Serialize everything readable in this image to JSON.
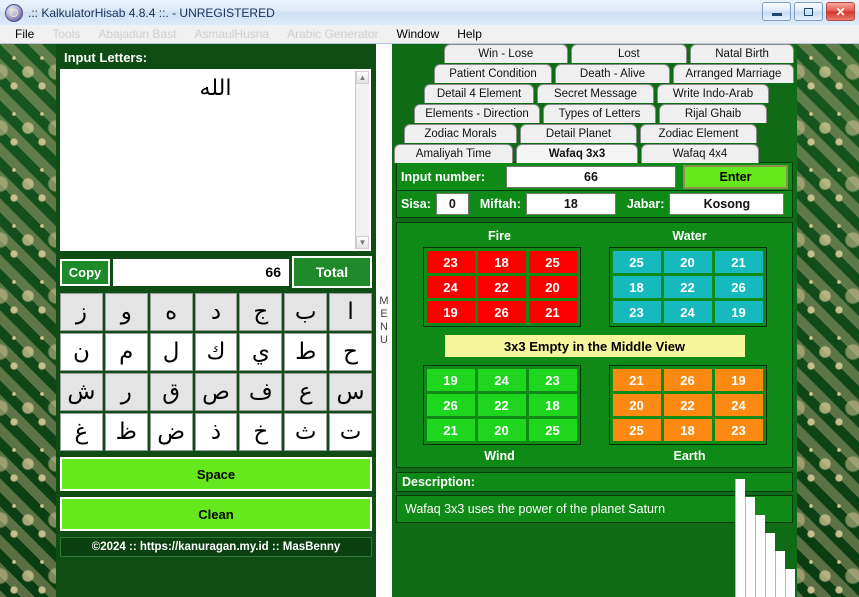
{
  "window": {
    "title": ".:: KalkulatorHisab 4.8.4 ::. - UNREGISTERED",
    "app_icon": "app-gear-icon",
    "minimize_label": "Minimize",
    "maximize_label": "Maximize",
    "close_label": "Close"
  },
  "menubar": {
    "items": [
      {
        "label": "File",
        "enabled": true
      },
      {
        "label": "Tools",
        "enabled": false
      },
      {
        "label": "Abajadun Bast",
        "enabled": false
      },
      {
        "label": "AsmaulHusna",
        "enabled": false
      },
      {
        "label": "Arabic Generator",
        "enabled": false
      },
      {
        "label": "Window",
        "enabled": true
      },
      {
        "label": "Help",
        "enabled": true
      }
    ]
  },
  "left_panel": {
    "title": "Input Letters:",
    "textarea_value": "الله",
    "scroll_up_icon": "chevron-up-icon",
    "scroll_down_icon": "chevron-down-icon",
    "copy_label": "Copy",
    "total_value": "66",
    "total_label": "Total",
    "keypad": [
      "ز",
      "و",
      "ه",
      "د",
      "ج",
      "ب",
      "ا",
      "ن",
      "م",
      "ل",
      "ك",
      "ي",
      "ط",
      "ح",
      "ش",
      "ر",
      "ق",
      "ص",
      "ف",
      "ع",
      "س",
      "غ",
      "ظ",
      "ض",
      "ذ",
      "خ",
      "ث",
      "ت"
    ],
    "space_label": "Space",
    "clean_label": "Clean",
    "footer": "©2024 ::   https://kanuragan.my.id   ::  MasBenny"
  },
  "divider": {
    "menu_letters": [
      "M",
      "E",
      "N",
      "U"
    ]
  },
  "right_panel": {
    "tab_rows": [
      [
        "Win - Lose",
        "Lost",
        "Natal Birth"
      ],
      [
        "Patient Condition",
        "Death - Alive",
        "Arranged Marriage"
      ],
      [
        "Detail 4 Element",
        "Secret Message",
        "Write Indo-Arab"
      ],
      [
        "Elements - Direction",
        "Types of Letters",
        "Rijal Ghaib"
      ],
      [
        "Zodiac Morals",
        "Detail Planet",
        "Zodiac Element"
      ],
      [
        "Amaliyah Time",
        "Wafaq 3x3",
        "Wafaq 4x4"
      ]
    ],
    "active_tab": "Wafaq 3x3",
    "input_number_label": "Input number:",
    "input_number_value": "66",
    "enter_label": "Enter",
    "sisa_label": "Sisa:",
    "sisa_value": "0",
    "miftah_label": "Miftah:",
    "miftah_value": "18",
    "jabar_label": "Jabar:",
    "jabar_value": "Kosong",
    "middle_banner": "3x3 Empty in the Middle View",
    "description_label": "Description:",
    "description_text": "Wafaq 3x3 uses the power of the planet Saturn"
  },
  "chart_data": {
    "type": "table",
    "title": "Wafaq 3x3 magic squares by element",
    "grids": [
      {
        "name": "Fire",
        "color": "#fc0000",
        "position": "top-left",
        "rows": [
          [
            23,
            18,
            25
          ],
          [
            24,
            22,
            20
          ],
          [
            19,
            26,
            21
          ]
        ]
      },
      {
        "name": "Water",
        "color": "#16b9bd",
        "position": "top-right",
        "rows": [
          [
            25,
            20,
            21
          ],
          [
            18,
            22,
            26
          ],
          [
            23,
            24,
            19
          ]
        ]
      },
      {
        "name": "Wind",
        "color": "#1ed61e",
        "position": "bottom-left",
        "rows": [
          [
            19,
            24,
            23
          ],
          [
            26,
            22,
            18
          ],
          [
            21,
            20,
            25
          ]
        ]
      },
      {
        "name": "Earth",
        "color": "#fc8a12",
        "position": "bottom-right",
        "rows": [
          [
            21,
            26,
            19
          ],
          [
            20,
            22,
            24
          ],
          [
            25,
            18,
            23
          ]
        ]
      }
    ]
  },
  "colors": {
    "fire": "#fc0000",
    "water": "#16b9bd",
    "wind": "#1ed61e",
    "earth": "#fc8a12",
    "panel_green": "#0f8a17",
    "accent_green": "#66e81e",
    "banner_yellow": "#f5f59b"
  }
}
